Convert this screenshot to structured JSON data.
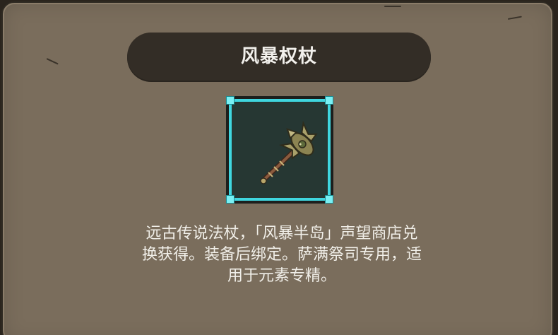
{
  "item": {
    "name": "风暴权杖",
    "icon": "staff-icon",
    "rarity_color": "#3fd6df",
    "description_lines": [
      "远古传说法杖，「风暴半岛」声望商店兑",
      "换获得。装备后绑定。萨满祭司专用，适",
      "用于元素专精。"
    ]
  }
}
